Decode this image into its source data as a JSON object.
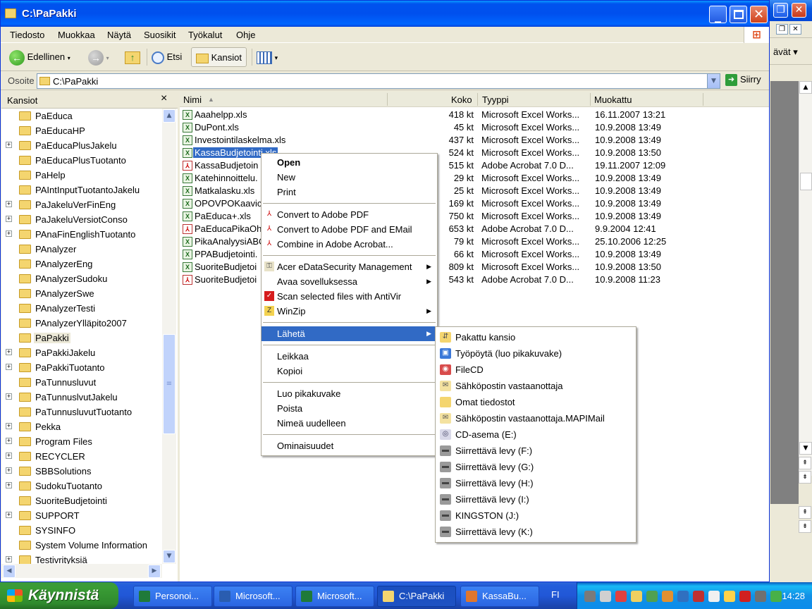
{
  "window": {
    "title": "C:\\PaPakki",
    "menu": [
      "Tiedosto",
      "Muokkaa",
      "Näytä",
      "Suosikit",
      "Työkalut",
      "Ohje"
    ],
    "toolbar": {
      "back": "Edellinen",
      "search": "Etsi",
      "folders": "Kansiot"
    },
    "address": {
      "label": "Osoite",
      "value": "C:\\PaPakki",
      "go": "Siirry"
    }
  },
  "background_window": {
    "toolbar_fragment": "ävät"
  },
  "folders_pane": {
    "title": "Kansiot",
    "items": [
      {
        "name": "PaEduca",
        "expandable": false
      },
      {
        "name": "PaEducaHP",
        "expandable": false
      },
      {
        "name": "PaEducaPlusJakelu",
        "expandable": true
      },
      {
        "name": "PaEducaPlusTuotanto",
        "expandable": false
      },
      {
        "name": "PaHelp",
        "expandable": false
      },
      {
        "name": "PAIntInputTuotantoJakelu",
        "expandable": false
      },
      {
        "name": "PaJakeluVerFinEng",
        "expandable": true
      },
      {
        "name": "PaJakeluVersiotConso",
        "expandable": true
      },
      {
        "name": "PAnaFinEnglishTuotanto",
        "expandable": true
      },
      {
        "name": "PAnalyzer",
        "expandable": false
      },
      {
        "name": "PAnalyzerEng",
        "expandable": false
      },
      {
        "name": "PAnalyzerSudoku",
        "expandable": false
      },
      {
        "name": "PAnalyzerSwe",
        "expandable": false
      },
      {
        "name": "PAnalyzerTesti",
        "expandable": false
      },
      {
        "name": "PAnalyzerYlläpito2007",
        "expandable": false
      },
      {
        "name": "PaPakki",
        "expandable": false,
        "selected": true
      },
      {
        "name": "PaPakkiJakelu",
        "expandable": true
      },
      {
        "name": "PaPakkiTuotanto",
        "expandable": true
      },
      {
        "name": "PaTunnusluvut",
        "expandable": false
      },
      {
        "name": "PaTunnuslvutJakelu",
        "expandable": true
      },
      {
        "name": "PaTunnusluvutTuotanto",
        "expandable": false
      },
      {
        "name": "Pekka",
        "expandable": true
      },
      {
        "name": "Program Files",
        "expandable": true
      },
      {
        "name": "RECYCLER",
        "expandable": true
      },
      {
        "name": "SBBSolutions",
        "expandable": true
      },
      {
        "name": "SudokuTuotanto",
        "expandable": true
      },
      {
        "name": "SuoriteBudjetointi",
        "expandable": false
      },
      {
        "name": "SUPPORT",
        "expandable": true
      },
      {
        "name": "SYSINFO",
        "expandable": false
      },
      {
        "name": "System Volume Information",
        "expandable": false
      },
      {
        "name": "Testivrityksiä",
        "expandable": true
      }
    ]
  },
  "file_list": {
    "columns": [
      "Nimi",
      "Koko",
      "Tyyppi",
      "Muokattu"
    ],
    "files": [
      {
        "name": "Aaahelpp.xls",
        "kind": "xls",
        "size": "418 kt",
        "type": "Microsoft Excel Works...",
        "modified": "16.11.2007 13:21"
      },
      {
        "name": "DuPont.xls",
        "kind": "xls",
        "size": "45 kt",
        "type": "Microsoft Excel Works...",
        "modified": "10.9.2008 13:49"
      },
      {
        "name": "Investointilaskelma.xls",
        "kind": "xls",
        "size": "437 kt",
        "type": "Microsoft Excel Works...",
        "modified": "10.9.2008 13:49"
      },
      {
        "name": "KassaBudjetointi.xls",
        "kind": "xls",
        "size": "524 kt",
        "type": "Microsoft Excel Works...",
        "modified": "10.9.2008 13:50",
        "selected": true
      },
      {
        "name": "KassaBudjetoin",
        "kind": "pdf",
        "size": "515 kt",
        "type": "Adobe Acrobat 7.0 D...",
        "modified": "19.11.2007 12:09"
      },
      {
        "name": "Katehinnoittelu.",
        "kind": "xls",
        "size": "29 kt",
        "type": "Microsoft Excel Works...",
        "modified": "10.9.2008 13:49"
      },
      {
        "name": "Matkalasku.xls",
        "kind": "xls",
        "size": "25 kt",
        "type": "Microsoft Excel Works...",
        "modified": "10.9.2008 13:49"
      },
      {
        "name": "OPOVPOKaavic",
        "kind": "xls",
        "size": "169 kt",
        "type": "Microsoft Excel Works...",
        "modified": "10.9.2008 13:49"
      },
      {
        "name": "PaEduca+.xls",
        "kind": "xls",
        "size": "750 kt",
        "type": "Microsoft Excel Works...",
        "modified": "10.9.2008 13:49"
      },
      {
        "name": "PaEducaPikaOh",
        "kind": "pdf",
        "size": "653 kt",
        "type": "Adobe Acrobat 7.0 D...",
        "modified": "9.9.2004 12:41"
      },
      {
        "name": "PikaAnalyysiABC",
        "kind": "xls",
        "size": "79 kt",
        "type": "Microsoft Excel Works...",
        "modified": "25.10.2006 12:25"
      },
      {
        "name": "PPABudjetointi.",
        "kind": "xls",
        "size": "66 kt",
        "type": "Microsoft Excel Works...",
        "modified": "10.9.2008 13:49"
      },
      {
        "name": "SuoriteBudjetoi",
        "kind": "xls",
        "size": "809 kt",
        "type": "Microsoft Excel Works...",
        "modified": "10.9.2008 13:50"
      },
      {
        "name": "SuoriteBudjetoi",
        "kind": "pdf",
        "size": "543 kt",
        "type": "Adobe Acrobat 7.0 D...",
        "modified": "10.9.2008 11:23"
      }
    ]
  },
  "context_menu": {
    "groups": [
      [
        {
          "label": "Open",
          "bold": true
        },
        {
          "label": "New"
        },
        {
          "label": "Print"
        }
      ],
      [
        {
          "label": "Convert to Adobe PDF",
          "icon": "pdf"
        },
        {
          "label": "Convert to Adobe PDF and EMail",
          "icon": "pdf"
        },
        {
          "label": "Combine in Adobe Acrobat...",
          "icon": "pdf"
        }
      ],
      [
        {
          "label": "Acer eDataSecurity Management",
          "icon": "lock",
          "submenu": true
        },
        {
          "label": "Avaa sovelluksessa",
          "submenu": true
        },
        {
          "label": "Scan selected files with AntiVir",
          "icon": "antivir"
        },
        {
          "label": "WinZip",
          "icon": "winzip",
          "submenu": true
        }
      ],
      [
        {
          "label": "Lähetä",
          "submenu": true,
          "highlighted": true
        }
      ],
      [
        {
          "label": "Leikkaa"
        },
        {
          "label": "Kopioi"
        }
      ],
      [
        {
          "label": "Luo pikakuvake"
        },
        {
          "label": "Poista"
        },
        {
          "label": "Nimeä uudelleen"
        }
      ],
      [
        {
          "label": "Ominaisuudet"
        }
      ]
    ]
  },
  "sendto_menu": [
    {
      "label": "Pakattu kansio",
      "icon": "zip-folder"
    },
    {
      "label": "Työpöytä (luo pikakuvake)",
      "icon": "desktop"
    },
    {
      "label": "FileCD",
      "icon": "filecd"
    },
    {
      "label": "Sähköpostin vastaanottaja",
      "icon": "mail"
    },
    {
      "label": "Omat tiedostot",
      "icon": "folder"
    },
    {
      "label": "Sähköpostin vastaanottaja.MAPIMail",
      "icon": "mail"
    },
    {
      "label": "CD-asema (E:)",
      "icon": "cd"
    },
    {
      "label": "Siirrettävä levy (F:)",
      "icon": "drive"
    },
    {
      "label": "Siirrettävä levy (G:)",
      "icon": "drive"
    },
    {
      "label": "Siirrettävä levy (H:)",
      "icon": "drive"
    },
    {
      "label": "Siirrettävä levy (I:)",
      "icon": "drive"
    },
    {
      "label": "KINGSTON (J:)",
      "icon": "drive"
    },
    {
      "label": "Siirrettävä levy (K:)",
      "icon": "drive"
    }
  ],
  "taskbar": {
    "start": "Käynnistä",
    "buttons": [
      {
        "label": "Personoi...",
        "icon": "excel",
        "active": false
      },
      {
        "label": "Microsoft...",
        "icon": "word",
        "active": false
      },
      {
        "label": "Microsoft...",
        "icon": "excel",
        "active": false
      },
      {
        "label": "C:\\PaPakki",
        "icon": "folder",
        "active": true
      },
      {
        "label": "KassaBu...",
        "icon": "office",
        "active": false
      }
    ],
    "language": "FI",
    "clock": "14:28"
  }
}
